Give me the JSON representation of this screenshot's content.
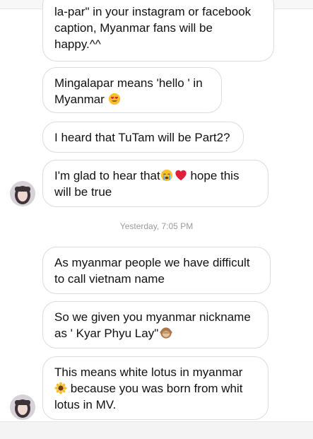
{
  "messages": [
    {
      "lines": [
        "la-par\" in your instagram or facebook",
        "caption, Myanmar fans will be",
        "happy.^^"
      ]
    },
    {
      "line1": "Mingalapar means 'hello ' in",
      "line2a": "Myanmar "
    },
    {
      "text": "I heard that TuTam will be Part2?"
    },
    {
      "line1a": "I'm glad to hear that",
      "line1b": " hope this",
      "line2": "will be true"
    },
    {
      "line1": "As myanmar people we have difficult",
      "line2": "to call vietnam name"
    },
    {
      "line1": "So we given you myanmar nickname",
      "line2a": "as ' Kyar Phyu  Lay\""
    },
    {
      "line1": "This means white lotus in myanmar",
      "line2b": " because you was born from whit",
      "line3": "lotus  in MV."
    }
  ],
  "timestamp": "Yesterday, 7:05 PM",
  "icons": {
    "heart_eyes": "heart-eyes-emoji",
    "crying": "crying-face-emoji",
    "heart": "red-heart-emoji",
    "monkey": "see-no-evil-monkey-emoji",
    "sunflower": "sunflower-emoji"
  },
  "colors": {
    "bubble_border": "#dcdcdc",
    "timestamp": "#9b9b9b",
    "heart": "#e0203a"
  }
}
